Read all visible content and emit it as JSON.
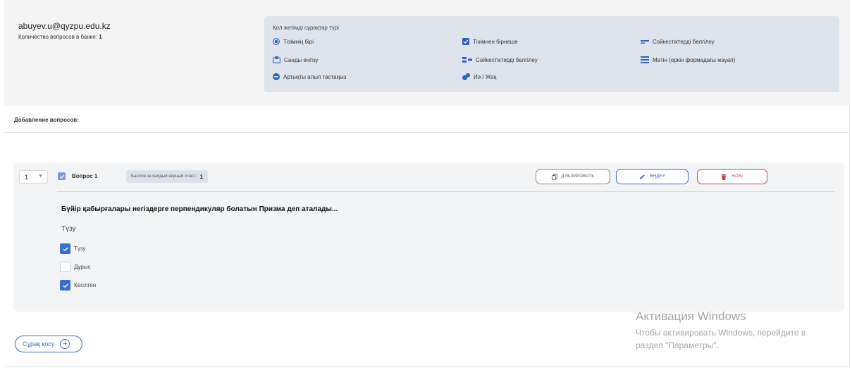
{
  "header": {
    "email": "abuyev.u@qyzpu.edu.kz",
    "bank_count_label": "Количество вопросов в банке:",
    "bank_count_value": "1"
  },
  "question_types": {
    "title": "Қол жетімді сұрақтар түрі",
    "items": [
      {
        "label": "Тізімнің бірі",
        "icon": "radio-icon"
      },
      {
        "label": "Тізімнен бірнеше",
        "icon": "checkbox-icon"
      },
      {
        "label": "Сәйкестіктерді белгілеу",
        "icon": "short-line-icon"
      },
      {
        "label": "Санды енгізу",
        "icon": "number-input-icon"
      },
      {
        "label": "Сәйкестіктерді белгілеу",
        "icon": "matching-icon"
      },
      {
        "label": "Мәтін (еркін формадағы жауап)",
        "icon": "text-lines-icon"
      },
      {
        "label": "Артықты алып тастаңыз",
        "icon": "minus-circle-icon"
      },
      {
        "label": "Иә / Жоқ",
        "icon": "yes-no-icon"
      }
    ]
  },
  "section": {
    "add_questions_label": "Добавление вопросов:"
  },
  "question": {
    "number": "1",
    "title": "Вопрос 1",
    "points_label": "Баллов за каждый верный ответ: :",
    "points_value": "1",
    "duplicate_label": "ДУБЛИРОВАТЬ",
    "edit_label": "ӨҢДЕУ",
    "delete_label": "ЖОЮ",
    "text": "Бүйір қабырғалары негіздерге перпендикуляр болатын Призма деп аталады...",
    "answer": "Түзу",
    "options": [
      {
        "label": "Түзу",
        "checked": true
      },
      {
        "label": "Дұрыс",
        "checked": false
      },
      {
        "label": "Кесілген",
        "checked": true
      }
    ]
  },
  "watermark": {
    "title": "Активация Windows",
    "line1": "Чтобы активировать Windows, перейдите в",
    "line2": "раздел \"Параметры\"."
  },
  "add_question_label": "Сұрақ қосу",
  "colors": {
    "accent": "#3a6fcc",
    "danger": "#b74949",
    "panel": "#dfe4ec",
    "header_bg": "#f4f4f4"
  }
}
